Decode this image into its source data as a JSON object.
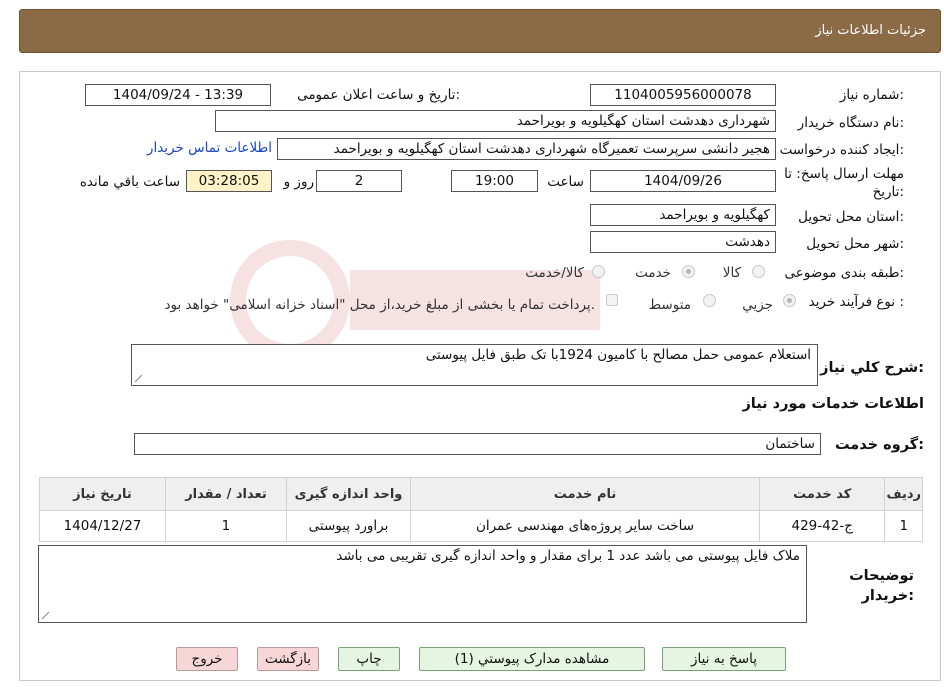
{
  "header": {
    "title": "جزئیات اطلاعات نیاز"
  },
  "form": {
    "need_number_label": "شماره نیاز:",
    "need_number": "1104005956000078",
    "announce_label": "تاریخ و ساعت اعلان عمومی:",
    "announce_value": "1404/09/24 - 13:39",
    "buyer_org_label": "نام دستگاه خريدار:",
    "buyer_org": "شهرداری دهدشت استان کهگیلویه و بویراحمد",
    "creator_label": "ايجاد کننده درخواست:",
    "creator": "هجیر دانشی سرپرست تعمیرگاه شهرداری دهدشت استان کهگیلویه و بویراحمد",
    "contact_link": "اطلاعات تماس خريدار",
    "deadline_label": "مهلت ارسال پاسخ: تا تاریخ:",
    "deadline_date": "1404/09/26",
    "hour_label": "ساعت",
    "deadline_time": "19:00",
    "days_value": "2",
    "days_label": "روز و",
    "remaining_time": "03:28:05",
    "remaining_label": "ساعت باقي مانده",
    "province_label": "استان محل تحویل:",
    "province": "کهگیلویه و بویراحمد",
    "city_label": "شهر محل تحویل:",
    "city": "دهدشت",
    "category_label": "طبقه بندی موضوعی:",
    "category_options": [
      "کالا",
      "خدمت",
      "کالا/خدمت"
    ],
    "process_label": "نوع فرآيند خريد :",
    "process_options": [
      "جزيي",
      "متوسط"
    ],
    "payment_note": "پرداخت تمام یا بخشی از مبلغ خرید،از محل \"اسناد خزانه اسلامی\" خواهد بود.",
    "summary_label": "شرح کلي نياز:",
    "summary": "استعلام عمومی حمل مصالح با کامیون 1924با تک طبق فایل پیوستی",
    "services_title": "اطلاعات خدمات مورد نياز",
    "service_group_label": "گروه خدمت:",
    "service_group": "ساختمان",
    "notes_label": "توضیحات خریدار:",
    "notes": "ملاک فایل پیوستی می باشد عدد 1 برای مقدار و واحد اندازه گیری تقریبی می باشد"
  },
  "table": {
    "headers": [
      "رديف",
      "کد خدمت",
      "نام خدمت",
      "واحد اندازه گيری",
      "تعداد / مقدار",
      "تاريخ نياز"
    ],
    "rows": [
      [
        "1",
        "ج-42-429",
        "ساخت سایر پروژه‌های مهندسی عمران",
        "براورد پیوستی",
        "1",
        "1404/12/27"
      ]
    ]
  },
  "buttons": {
    "reply": "پاسخ به نياز",
    "view_docs": "مشاهده مدارک پيوستي (1)",
    "print": "چاپ",
    "back": "بازگشت",
    "exit": "خروج"
  },
  "colors": {
    "header_bg": "#8b6b45",
    "button_green": "#e6f5e2",
    "button_pink": "#f7d6d8",
    "remaining_bg": "#fdf3c6"
  }
}
